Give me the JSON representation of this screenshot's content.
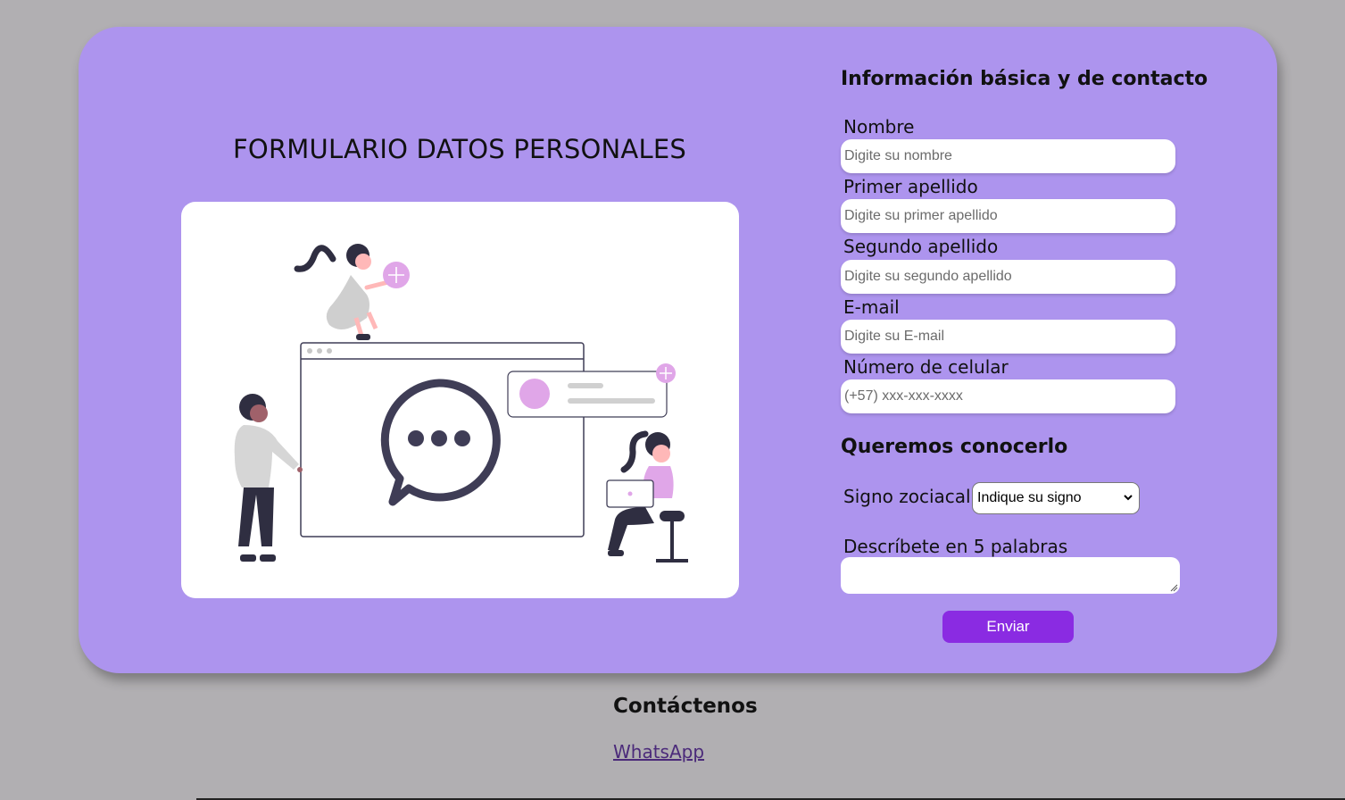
{
  "page": {
    "title": "FORMULARIO DATOS PERSONALES"
  },
  "form": {
    "section_basic_title": "Información básica y de contacto",
    "fields": [
      {
        "label": "Nombre",
        "placeholder": "Digite su nombre",
        "value": ""
      },
      {
        "label": "Primer apellido",
        "placeholder": "Digite su primer apellido",
        "value": ""
      },
      {
        "label": "Segundo apellido",
        "placeholder": "Digite su segundo apellido",
        "value": ""
      },
      {
        "label": "E-mail",
        "placeholder": "Digite su E-mail",
        "value": ""
      },
      {
        "label": "Número de celular",
        "placeholder": "(+57) xxx-xxx-xxxx",
        "value": ""
      }
    ],
    "section_know_title": "Queremos conocerlo",
    "sign": {
      "label": "Signo zociacal",
      "selected": "Indique su signo"
    },
    "describe": {
      "label": "Descríbete en 5 palabras",
      "value": ""
    },
    "submit_label": "Enviar"
  },
  "footer": {
    "heading": "Contáctenos",
    "link_label": "WhatsApp"
  },
  "icons": {
    "illustration": "people-chatting-illustration",
    "select_chevron": "chevron-down-icon",
    "resize_grip": "resize-grip-icon"
  },
  "colors": {
    "page_background": "#b1afb2",
    "card": "#ad94ee",
    "submit_button": "#8a2be2",
    "illustration_accent": "#e0a6e8",
    "illustration_dark": "#3f3d56"
  }
}
